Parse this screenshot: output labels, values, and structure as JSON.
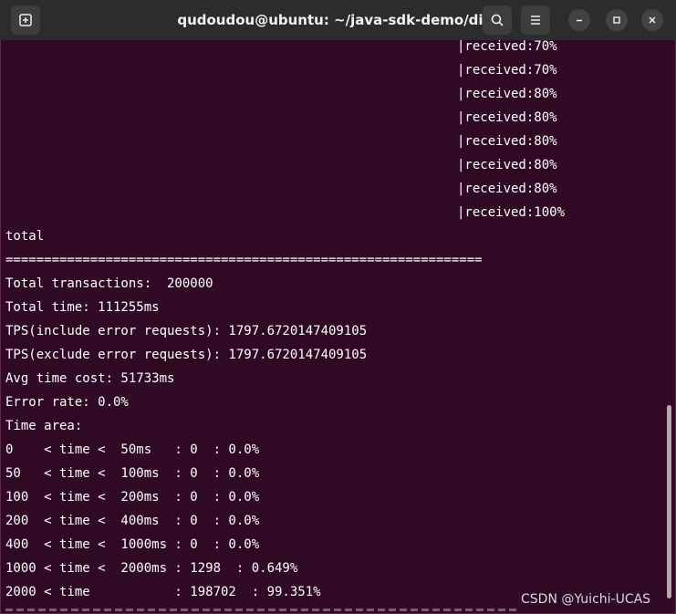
{
  "window": {
    "title": "qudoudou@ubuntu: ~/java-sdk-demo/dist"
  },
  "icons": {
    "new_tab": "new-tab-icon",
    "search": "search-icon",
    "menu": "hamburger-menu-icon",
    "minimize": "minimize-icon",
    "maximize": "maximize-icon",
    "close": "close-icon"
  },
  "colors": {
    "terminal_bg": "#300a24",
    "titlebar_bg": "#2c2c2c",
    "text": "#ffffff"
  },
  "terminal": {
    "received_lines": [
      "|received:70%",
      "|received:70%",
      "|received:80%",
      "|received:80%",
      "|received:80%",
      "|received:80%",
      "|received:80%",
      "|received:100%"
    ],
    "total_label": "total",
    "separator": "==============================================================",
    "total_transactions": "Total transactions:  200000",
    "total_time": "Total time: 111255ms",
    "tps_include": "TPS(include error requests): 1797.6720147409105",
    "tps_exclude": "TPS(exclude error requests): 1797.6720147409105",
    "avg_time": "Avg time cost: 51733ms",
    "error_rate": "Error rate: 0.0%",
    "time_area_label": "Time area:",
    "time_areas": [
      "0    < time <  50ms   : 0  : 0.0%",
      "50   < time <  100ms  : 0  : 0.0%",
      "100  < time <  200ms  : 0  : 0.0%",
      "200  < time <  400ms  : 0  : 0.0%",
      "400  < time <  1000ms : 0  : 0.0%",
      "1000 < time <  2000ms : 1298  : 0.649%",
      "2000 < time           : 198702  : 99.351%"
    ]
  },
  "watermark": "CSDN @Yuichi-UCAS"
}
